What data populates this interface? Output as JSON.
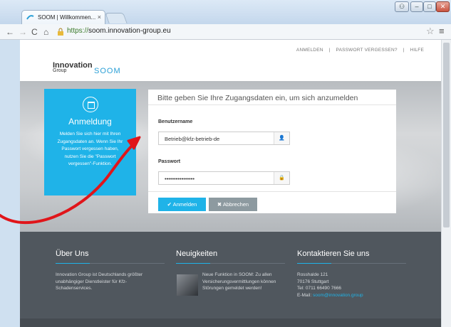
{
  "browser": {
    "tab_title": "SOOM | Willkommen...",
    "tab_close": "×",
    "url_protocol": "https://",
    "url_host": "soom.innovation-group.eu",
    "window_controls": {
      "user": "⚇",
      "minimize": "–",
      "maximize": "□",
      "close": "✕"
    },
    "nav": {
      "back": "←",
      "forward": "→",
      "reload": "C",
      "home": "⌂",
      "star": "☆",
      "menu": "≡"
    }
  },
  "topnav": {
    "items": [
      "ANMELDEN",
      "PASSWORT VERGESSEN?",
      "HILFE"
    ],
    "separator": "|"
  },
  "logo": {
    "line1": "Innovation",
    "line2": "Group",
    "product": "SOOM"
  },
  "login_info": {
    "heading": "Anmeldung",
    "text": "Melden Sie sich hier mit Ihren Zugangsdaten an. Wenn Sie Ihr Passwort vergessen haben, nutzen Sie die \"Passwort vergessen\"-Funktion."
  },
  "form": {
    "title": "Bitte geben Sie Ihre Zugangsdaten ein, um sich anzumelden",
    "username_label": "Benutzername",
    "username_value": "Betrieb@kfz-betrieb-de",
    "username_icon": "👤",
    "password_label": "Passwort",
    "password_value": "••••••••••••••••",
    "password_icon": "🔒",
    "login_button": "✔ Anmelden",
    "cancel_button": "✖ Abbrechen"
  },
  "footer": {
    "about_title": "Über Uns",
    "about_text": "Innovation Group ist Deutschlands größter unabhängiger Dienstleister für Kfz-Schadenservices.",
    "news_title": "Neuigkeiten",
    "news_text": "Neue Funktion in SOOM: Zu allen Versicherungsvermittlungen können Störungen gemeldet werden!",
    "contact_title": "Kontaktieren Sie uns",
    "contact_street": "Rosshalde 121",
    "contact_city": "70176 Stuttgart",
    "contact_phone": "Tel: 0711 66490 7666",
    "contact_email_label": "E-Mail:",
    "contact_email": "soom@innovation.group"
  },
  "colors": {
    "accent": "#1fb3e8",
    "annotation_arrow": "#e0151a",
    "footer_bg": "#50575e"
  }
}
